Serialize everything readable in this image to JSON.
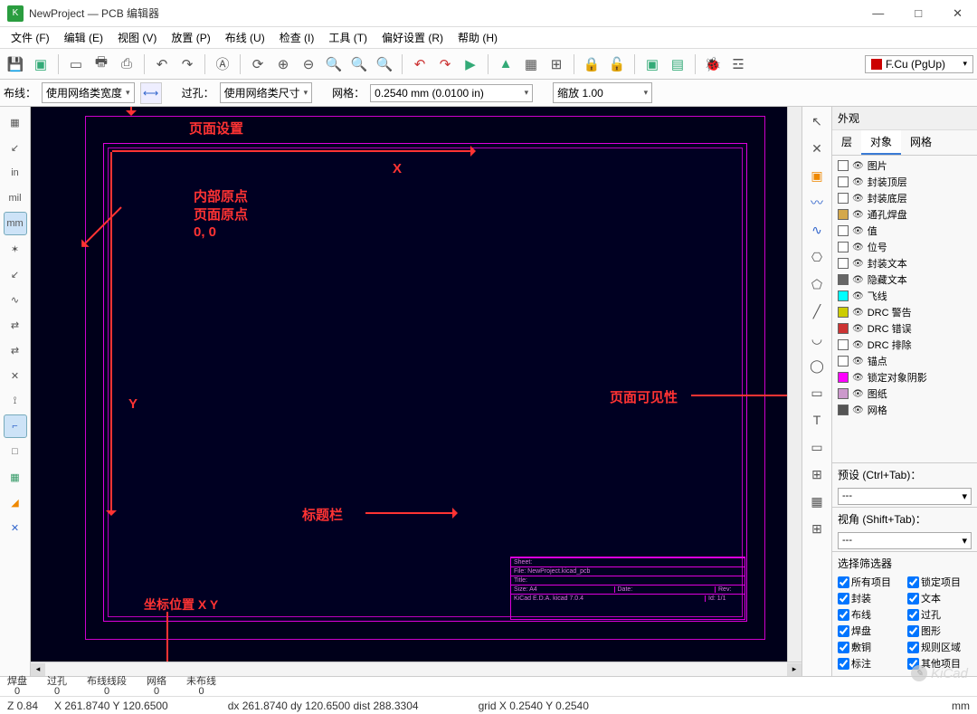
{
  "title": "NewProject — PCB 编辑器",
  "window_controls": {
    "min": "—",
    "max": "□",
    "close": "✕"
  },
  "menus": [
    "文件 (F)",
    "编辑 (E)",
    "视图 (V)",
    "放置 (P)",
    "布线 (U)",
    "检查 (I)",
    "工具 (T)",
    "偏好设置 (R)",
    "帮助 (H)"
  ],
  "layer_selector": "F.Cu (PgUp)",
  "secondary": {
    "track_label": "布线：",
    "track_value": "使用网络类宽度",
    "via_label": "过孔：",
    "via_value": "使用网络类尺寸",
    "grid_label": "网格：",
    "grid_value": "0.2540 mm (0.0100 in)",
    "zoom_label": "缩放",
    "zoom_value": "1.00"
  },
  "left_tools": [
    "▦",
    "↙",
    "in",
    "mil",
    "mm",
    "✶",
    "↙",
    "∿",
    "⇄",
    "⇄",
    "✕",
    "⟟",
    "⌐",
    "□",
    "▦",
    "◢",
    "✕"
  ],
  "right_tools": [
    "↖",
    "✕",
    "▣",
    "〰",
    "∿",
    "⎔",
    "⬠",
    "╱",
    "◡",
    "◯",
    "▭",
    "T",
    "▭",
    "⊞",
    "▦"
  ],
  "appearance": {
    "title": "外观",
    "tabs": [
      "层",
      "对象",
      "网格"
    ],
    "active_tab": 1,
    "items": [
      {
        "c": "",
        "t": "图片"
      },
      {
        "c": "",
        "t": "封装顶层"
      },
      {
        "c": "",
        "t": "封装底层"
      },
      {
        "c": "#d4a84b",
        "t": "通孔焊盘"
      },
      {
        "c": "",
        "t": "值"
      },
      {
        "c": "",
        "t": "位号"
      },
      {
        "c": "",
        "t": "封装文本"
      },
      {
        "c": "#666",
        "t": "隐藏文本"
      },
      {
        "c": "#0ff",
        "t": "飞线"
      },
      {
        "c": "#cc0",
        "t": "DRC 警告"
      },
      {
        "c": "#c33",
        "t": "DRC 错误"
      },
      {
        "c": "",
        "t": "DRC 排除"
      },
      {
        "c": "",
        "t": "锚点"
      },
      {
        "c": "#f0f",
        "t": "锁定对象阴影"
      },
      {
        "c": "#c9c",
        "t": "图纸"
      },
      {
        "c": "#555",
        "t": "网格"
      }
    ],
    "preset_label": "预设 (Ctrl+Tab)：",
    "preset_value": "---",
    "view_label": "视角 (Shift+Tab)：",
    "view_value": "---"
  },
  "filter": {
    "title": "选择筛选器",
    "rows": [
      [
        "所有项目",
        "锁定项目"
      ],
      [
        "封装",
        "文本"
      ],
      [
        "布线",
        "过孔"
      ],
      [
        "焊盘",
        "图形"
      ],
      [
        "敷铜",
        "规则区域"
      ],
      [
        "标注",
        "其他项目"
      ]
    ]
  },
  "annotations": {
    "page_setup": "页面设置",
    "origin1": "内部原点",
    "origin2": "页面原点",
    "origin3": "0, 0",
    "x_label": "X",
    "y_label": "Y",
    "title_block": "标题栏",
    "page_vis": "页面可见性",
    "coord": "坐标位置 X Y"
  },
  "titleblock": {
    "l1": "Sheet:",
    "l2": "File: NewProject.kicad_pcb",
    "l3": "Title:",
    "l4a": "Size: A4",
    "l4b": "Date:",
    "l5a": "KiCad E.D.A.  kicad 7.0.4",
    "l5b": "Rev:",
    "l5c": "Id: 1/1"
  },
  "status1": {
    "pad_l": "焊盘",
    "pad_v": "0",
    "via_l": "过孔",
    "via_v": "0",
    "seg_l": "布线线段",
    "seg_v": "0",
    "net_l": "网络",
    "net_v": "0",
    "unr_l": "未布线",
    "unr_v": "0"
  },
  "status2": {
    "z": "Z 0.84",
    "xy": "X 261.8740  Y 120.6500",
    "d": "dx 261.8740  dy 120.6500  dist 288.3304",
    "g": "grid X 0.2540  Y 0.2540",
    "u": "mm"
  },
  "watermark": "KiCad"
}
